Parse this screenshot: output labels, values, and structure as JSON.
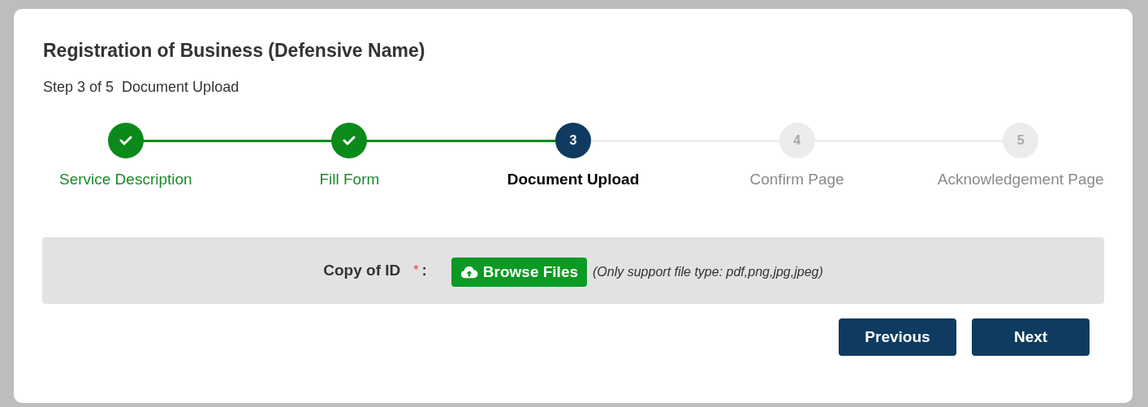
{
  "title": "Registration of Business (Defensive Name)",
  "subtitle": {
    "step": "Step 3 of 5",
    "name": "Document Upload"
  },
  "steps": [
    {
      "label": "Service Description",
      "completed": true,
      "selected": false
    },
    {
      "label": "Fill Form",
      "completed": true,
      "selected": false
    },
    {
      "label": "Document Upload",
      "completed": false,
      "selected": true,
      "number": "3"
    },
    {
      "label": "Confirm Page",
      "completed": false,
      "selected": false,
      "number": "4"
    },
    {
      "label": "Acknowledgement Page",
      "completed": false,
      "selected": false,
      "number": "5"
    }
  ],
  "upload": {
    "label": "Copy of ID",
    "required_mark": "*",
    "separator": ":",
    "button": "Browse Files",
    "hint": "(Only support file type: pdf,png,jpg,jpeg)"
  },
  "buttons": [
    "Previous",
    "Next"
  ]
}
